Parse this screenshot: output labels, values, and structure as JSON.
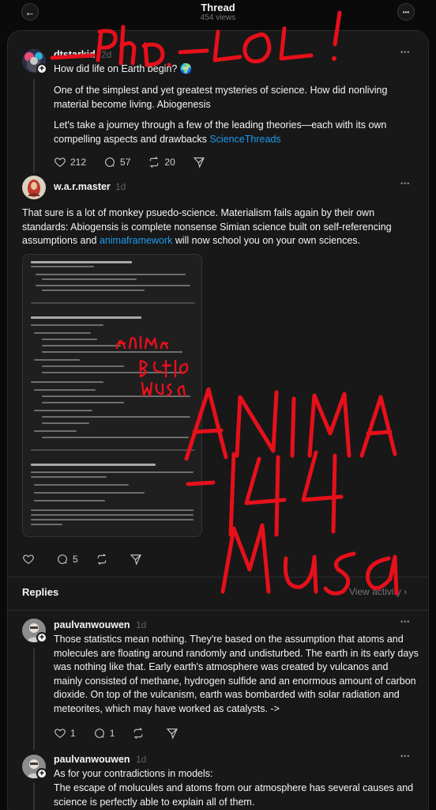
{
  "header": {
    "title": "Thread",
    "views": "454 views",
    "back_icon": "←",
    "more_icon": "•••"
  },
  "colors": {
    "background": "#0a0a0a",
    "panel": "#181818",
    "link": "#1d9bf0",
    "scribble": "#e6101b"
  },
  "original_post": {
    "username": "dtstarkid",
    "timestamp": "2d",
    "question": "How did life on Earth begin? 🌍",
    "paragraph1": "One of the simplest and yet greatest mysteries of science. How did nonliving material become living. Abiogenesis",
    "paragraph2_text": "Let's take a journey through a few of the leading theories—each with its own compelling aspects and drawbacks ",
    "paragraph2_link": "ScienceThreads",
    "likes": "212",
    "comments": "57",
    "reposts": "20",
    "more_icon": "•••"
  },
  "reply_post": {
    "username": "w.a.r.master",
    "timestamp": "1d",
    "text_part1": "That sure is a lot of monkey psuedo-science. Materialism fails again by their own standards: Abiogensis is complete nonsense Simian science built on self-referencing assumptions and ",
    "text_link": "animaframework",
    "text_part2": " will now school you on your own sciences.",
    "likes": "",
    "comments": "5",
    "more_icon": "•••"
  },
  "attached_document": {
    "title": "ANIMA Insight: The Spiritual and Scientific Divide",
    "section": "Step 3: Hyper-Granular Evidence for Impossibility",
    "subsection": "Statistical Improbabilities (Revisited):",
    "contradictions": "Contradictions in Models:",
    "conclusion": "Conclusion: A Superiority of Design Over Accident"
  },
  "replies_section": {
    "label": "Replies",
    "view_activity": "View activity",
    "chevron_icon": "›"
  },
  "replies": [
    {
      "username": "paulvanwouwen",
      "timestamp": "1d",
      "text": "Those statistics mean nothing. They're based on the assumption that atoms and molecules are floating around randomly and undisturbed. The earth in its early days was nothing like that. Early earth's atmosphere was created by vulcanos and mainly consisted of methane, hydrogen sulfide and an enormous amount of carbon dioxide. On top of the vulcanism, earth was bombarded with solar radiation and meteorites, which may have worked as catalysts. ->",
      "likes": "1",
      "comments": "1",
      "more_icon": "•••"
    },
    {
      "username": "paulvanwouwen",
      "timestamp": "1d",
      "text_line1": "As for your contradictions in models:",
      "text_line2": "The escape of molucules and atoms from our atmosphere has several causes and science is perfectly able to explain all of them.",
      "more_icon": "•••"
    }
  ]
}
